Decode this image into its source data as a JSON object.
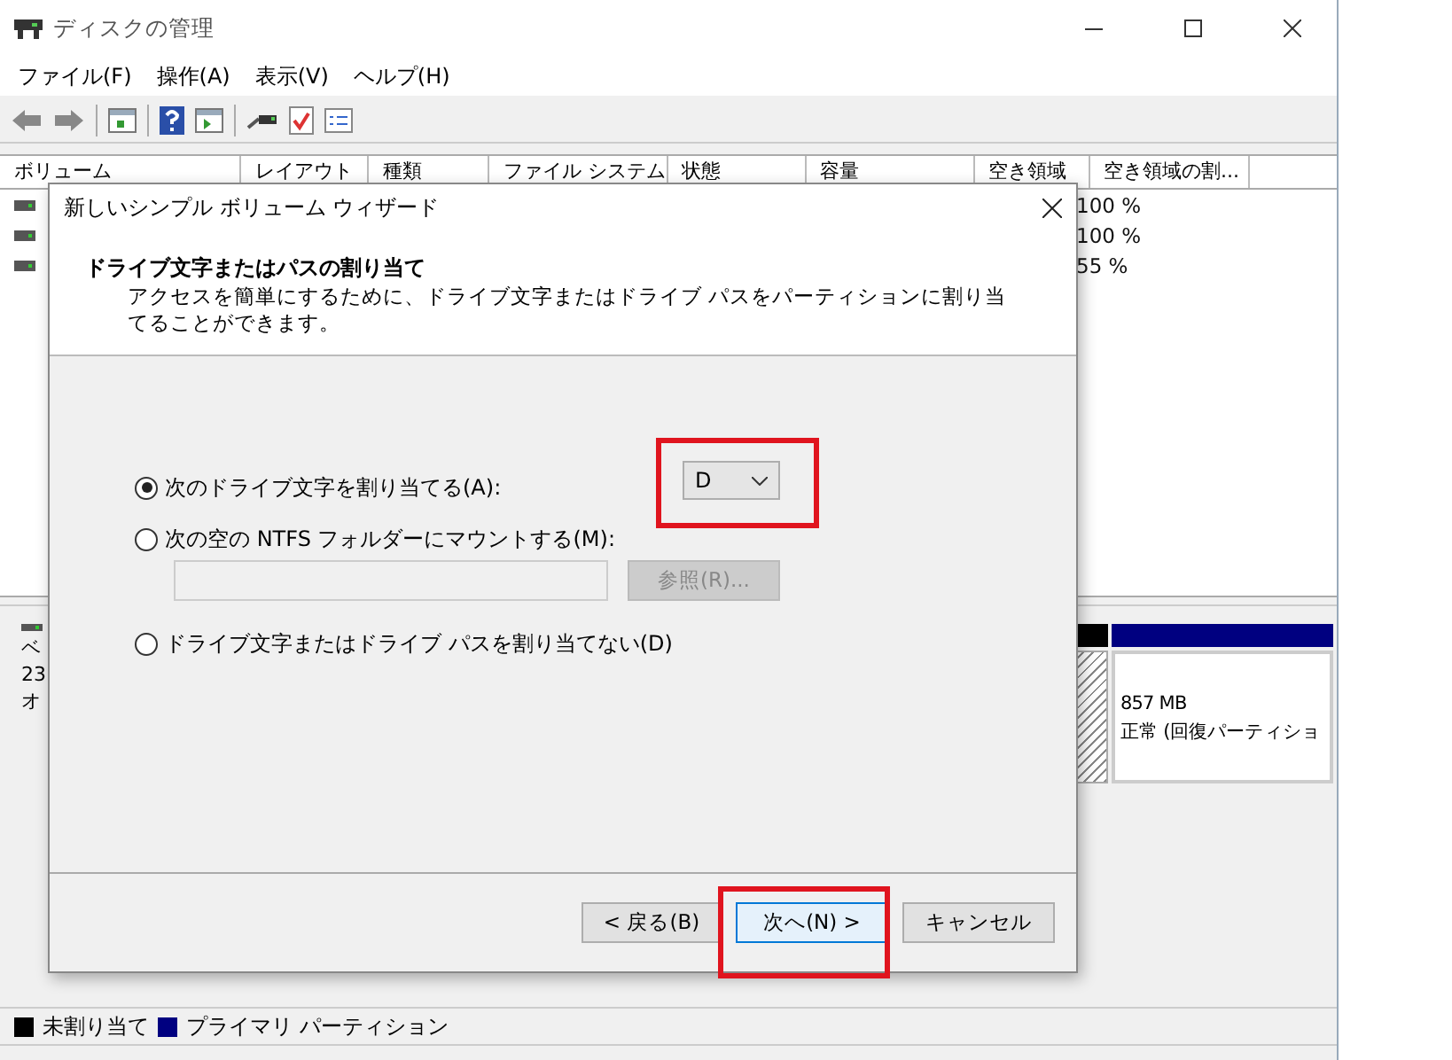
{
  "window": {
    "title": "ディスクの管理",
    "menu": [
      "ファイル(F)",
      "操作(A)",
      "表示(V)",
      "ヘルプ(H)"
    ]
  },
  "volume_table": {
    "columns": [
      "ボリューム",
      "レイアウト",
      "種類",
      "ファイル システム",
      "状態",
      "容量",
      "空き領域",
      "空き領域の割..."
    ],
    "rows": [
      {
        "free_percent": "100 %"
      },
      {
        "free_percent": "100 %"
      },
      {
        "free_percent": "55 %"
      }
    ]
  },
  "disk_pane": {
    "disk_label": [
      "ベ",
      "23",
      "オ"
    ],
    "partitions": [
      {
        "kind": "unallocated",
        "color": "#000000"
      },
      {
        "kind": "primary",
        "color": "#000080",
        "size": "857 MB",
        "status": "正常 (回復パーティショ"
      }
    ]
  },
  "legend": [
    {
      "label": "未割り当て",
      "color": "#000000"
    },
    {
      "label": "プライマリ パーティション",
      "color": "#000080"
    }
  ],
  "dialog": {
    "title": "新しいシンプル ボリューム ウィザード",
    "heading": "ドライブ文字またはパスの割り当て",
    "description": "アクセスを簡単にするために、ドライブ文字またはドライブ パスをパーティションに割り当てることができます。",
    "options": [
      {
        "label": "次のドライブ文字を割り当てる(A):",
        "selected": true
      },
      {
        "label": "次の空の NTFS フォルダーにマウントする(M):",
        "selected": false
      },
      {
        "label": "ドライブ文字またはドライブ パスを割り当てない(D)",
        "selected": false
      }
    ],
    "drive_letter": "D",
    "folder_field": {
      "disabled": true
    },
    "browse_button": {
      "label": "参照(R)...",
      "disabled": true
    },
    "buttons": [
      {
        "label": "< 戻る(B)",
        "default": false
      },
      {
        "label": "次へ(N) >",
        "default": true
      },
      {
        "label": "キャンセル",
        "default": false
      }
    ]
  }
}
